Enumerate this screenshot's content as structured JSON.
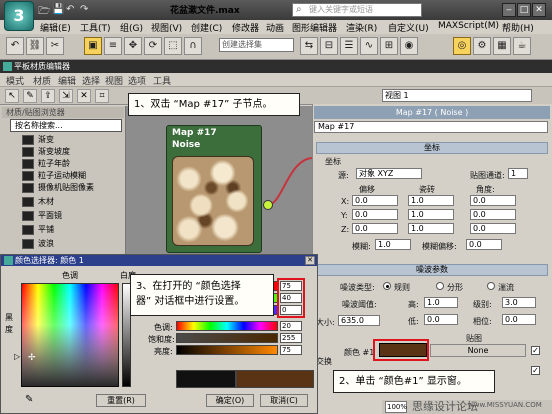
{
  "app": {
    "title": "花盆漱文件.max",
    "search_placeholder": "键入关键字或短语",
    "logo_glyph": "3"
  },
  "menu": [
    "编辑(E)",
    "工具(T)",
    "组(G)",
    "视图(V)",
    "创建(C)",
    "修改器",
    "动画",
    "图形编辑器",
    "渲染(R)",
    "自定义(U)",
    "MAXScript(M)",
    "帮助(H)"
  ],
  "toolbar": {
    "selection_set_placeholder": "创建选择集"
  },
  "slate": {
    "title": "平板材质编辑器",
    "menu": [
      "模式",
      "材质",
      "编辑",
      "选择",
      "视图",
      "选项",
      "工具"
    ],
    "view_select": "视图 1"
  },
  "browser": {
    "header": "材质/贴图浏览器",
    "search_placeholder": "按名称搜索...",
    "items": [
      "渐变",
      "渐变坡度",
      "粒子年龄",
      "粒子运动模糊",
      "摄像机贴图像素",
      "木材",
      "平面镜",
      "平铺",
      "波浪"
    ]
  },
  "node": {
    "title": "Map #17",
    "subtitle": "Noise"
  },
  "params": {
    "title": "Map #17  ( Noise )",
    "name": "Map #17",
    "coords": {
      "header": "坐标",
      "source_label": "源:",
      "source_value": "对象 XYZ",
      "channel_label": "贴图通道:",
      "channel_value": "1",
      "col_headers": [
        "偏移",
        "瓷砖",
        "角度:"
      ],
      "rows": [
        {
          "axis": "X:",
          "offset": "0.0",
          "tile": "1.0",
          "angle": "0.0"
        },
        {
          "axis": "Y:",
          "offset": "0.0",
          "tile": "1.0",
          "angle": "0.0"
        },
        {
          "axis": "Z:",
          "offset": "0.0",
          "tile": "1.0",
          "angle": "0.0"
        }
      ],
      "blur_label": "模糊:",
      "blur_value": "1.0",
      "blur_offset_label": "模糊偏移:",
      "blur_offset_value": "0.0"
    },
    "noise": {
      "header": "噪波参数",
      "type_label": "噪波类型:",
      "types": [
        "规则",
        "分形",
        "湍流"
      ],
      "threshold_label": "噪波阈值:",
      "high_label": "高:",
      "high_value": "1.0",
      "levels_label": "级别:",
      "levels_value": "3.0",
      "low_label": "低:",
      "low_value": "0.0",
      "phase_label": "相位:",
      "phase_value": "0.0",
      "size_label": "大小:",
      "size_value": "635.0",
      "map_label": "贴图",
      "swap_label": "交换",
      "color1_label": "颜色 #1",
      "none_label": "None"
    }
  },
  "color_dialog": {
    "title": "颜色选择器: 颜色 1",
    "hue_label": "色调",
    "white_label": "白度",
    "black_label": "黑度",
    "channels": [
      {
        "label": "红:",
        "value": "75"
      },
      {
        "label": "绿:",
        "value": "40"
      },
      {
        "label": "蓝:",
        "value": "0"
      },
      {
        "label": "色调:",
        "value": "20"
      },
      {
        "label": "饱和度:",
        "value": "255"
      },
      {
        "label": "亮度:",
        "value": "75"
      }
    ],
    "reset_label": "重置(R)",
    "ok_label": "确定(O)",
    "cancel_label": "取消(C)",
    "current_color": "#4b2800"
  },
  "callouts": {
    "step1": "1、双击 “Map #17” 子节点。",
    "step2": "2、单击 “颜色#1” 显示窗。",
    "step3_line1": "3、在打开的 “颜色选择",
    "step3_line2": "器” 对话框中进行设置。"
  },
  "watermark": {
    "text1": "思缘设计论坛",
    "text2": "www.MISSYUAN.COM"
  },
  "status_zoom": "100%"
}
